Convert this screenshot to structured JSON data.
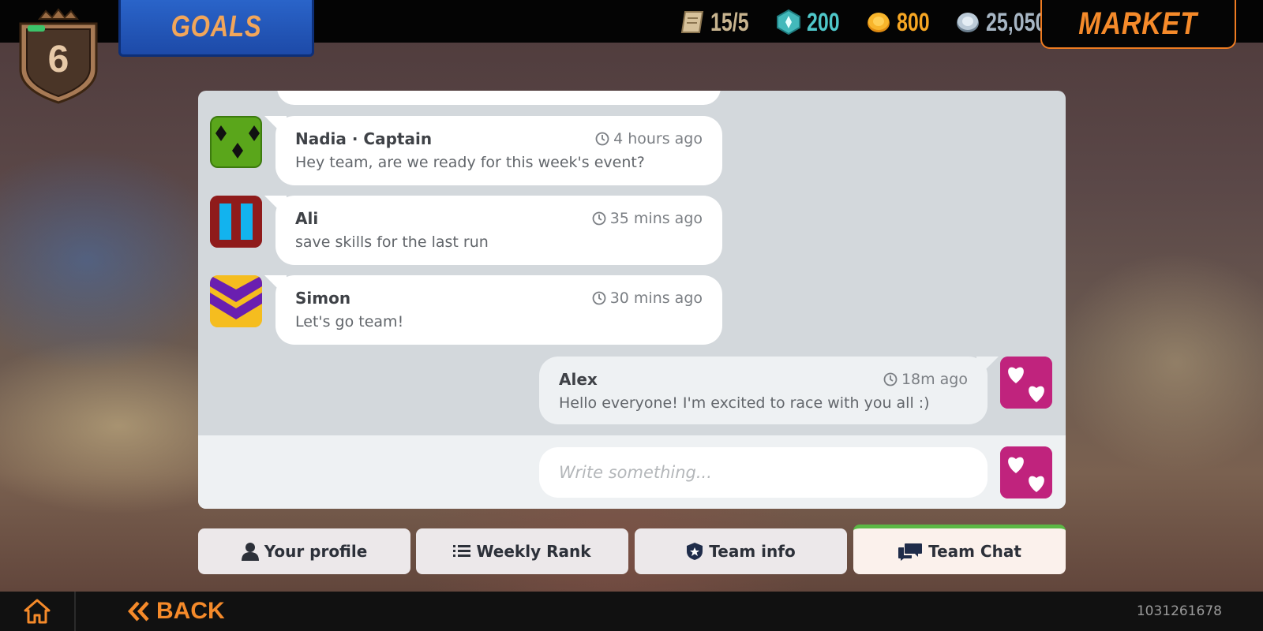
{
  "header": {
    "goals_label": "GOALS",
    "level": "6",
    "market_label": "MARKET",
    "currencies": [
      {
        "name": "tickets",
        "icon": "ticket-icon",
        "value": "15/5",
        "color": "#c8b48f"
      },
      {
        "name": "gems",
        "icon": "gem-icon",
        "value": "200",
        "color": "#4fc7c9"
      },
      {
        "name": "gold",
        "icon": "gold-coin-icon",
        "value": "800",
        "color": "#f6a623"
      },
      {
        "name": "silver",
        "icon": "silver-coin-icon",
        "value": "25,050",
        "color": "#a7b6c4"
      }
    ]
  },
  "chat": {
    "messages": [
      {
        "name": "Nadia · Captain",
        "time": "4 hours ago",
        "text": "Hey team, are we ready for this week's event?",
        "avatar": "green-diamonds-avatar"
      },
      {
        "name": "Ali",
        "time": "35 mins ago",
        "text": "save skills for the last run",
        "avatar": "red-blue-stripes-avatar"
      },
      {
        "name": "Simon",
        "time": "30 mins ago",
        "text": "Let's go team!",
        "avatar": "purple-chevron-avatar"
      }
    ],
    "own_message": {
      "name": "Alex",
      "time": "18m ago",
      "text": "Hello everyone! I'm excited to race with you all :)",
      "avatar": "pink-hearts-avatar"
    },
    "compose_placeholder": "Write something..."
  },
  "tabs": [
    {
      "label": "Your profile",
      "icon": "person-icon",
      "active": false
    },
    {
      "label": "Weekly Rank",
      "icon": "list-icon",
      "active": false
    },
    {
      "label": "Team info",
      "icon": "shield-icon",
      "active": false
    },
    {
      "label": "Team Chat",
      "icon": "chat-icon",
      "active": true
    }
  ],
  "footer": {
    "back_label": "BACK",
    "build_id": "1031261678"
  },
  "colors": {
    "accent_orange": "#f58a2a",
    "active_tab_bar": "#5bb845",
    "goals_blue": "#2a64c9"
  }
}
